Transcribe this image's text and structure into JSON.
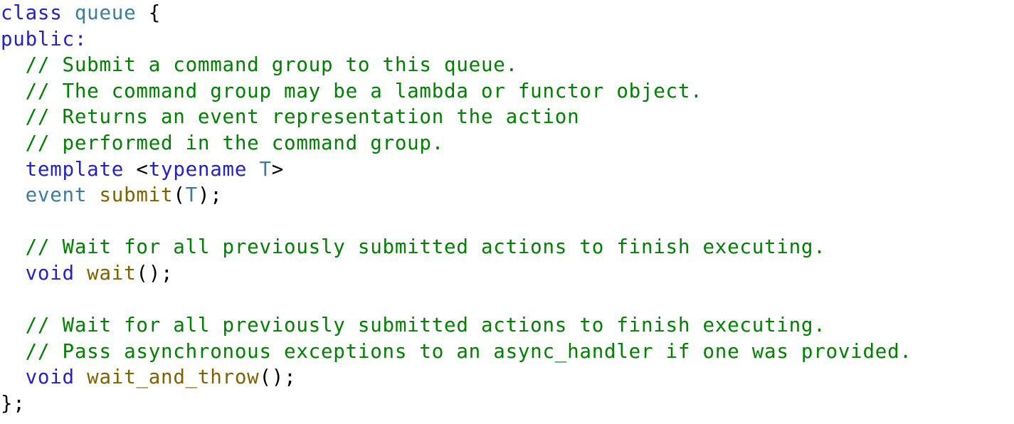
{
  "document": {
    "kind": "source-code-listing",
    "language": "C++",
    "background_color": "#ffffff"
  },
  "theme": {
    "keyword_color": "#2222cc",
    "type_color": "#3a7d9e",
    "function_color": "#806000",
    "comment_color": "#008000",
    "punctuation_color": "#000000"
  },
  "code": {
    "lines": [
      {
        "index": 1,
        "text": "class queue {",
        "tokens": [
          {
            "text": "class",
            "kind": "keyword"
          },
          {
            "text": " ",
            "kind": "plain"
          },
          {
            "text": "queue",
            "kind": "type"
          },
          {
            "text": " ",
            "kind": "plain"
          },
          {
            "text": "{",
            "kind": "punct"
          }
        ]
      },
      {
        "index": 2,
        "text": "public:",
        "tokens": [
          {
            "text": "public",
            "kind": "keyword"
          },
          {
            "text": ":",
            "kind": "keyword"
          }
        ]
      },
      {
        "index": 3,
        "text": "  // Submit a command group to this queue.",
        "tokens": [
          {
            "text": "  ",
            "kind": "plain"
          },
          {
            "text": "// Submit a command group to this queue.",
            "kind": "comment"
          }
        ]
      },
      {
        "index": 4,
        "text": "  // The command group may be a lambda or functor object.",
        "tokens": [
          {
            "text": "  ",
            "kind": "plain"
          },
          {
            "text": "// The command group may be a lambda or functor object.",
            "kind": "comment"
          }
        ]
      },
      {
        "index": 5,
        "text": "  // Returns an event representation the action",
        "tokens": [
          {
            "text": "  ",
            "kind": "plain"
          },
          {
            "text": "// Returns an event representation the action",
            "kind": "comment"
          }
        ]
      },
      {
        "index": 6,
        "text": "  // performed in the command group.",
        "tokens": [
          {
            "text": "  ",
            "kind": "plain"
          },
          {
            "text": "// performed in the command group.",
            "kind": "comment"
          }
        ]
      },
      {
        "index": 7,
        "text": "  template <typename T>",
        "tokens": [
          {
            "text": "  ",
            "kind": "plain"
          },
          {
            "text": "template",
            "kind": "keyword"
          },
          {
            "text": " ",
            "kind": "plain"
          },
          {
            "text": "<",
            "kind": "punct"
          },
          {
            "text": "typename",
            "kind": "keyword"
          },
          {
            "text": " ",
            "kind": "plain"
          },
          {
            "text": "T",
            "kind": "type"
          },
          {
            "text": ">",
            "kind": "punct"
          }
        ]
      },
      {
        "index": 8,
        "text": "  event submit(T);",
        "tokens": [
          {
            "text": "  ",
            "kind": "plain"
          },
          {
            "text": "event",
            "kind": "type"
          },
          {
            "text": " ",
            "kind": "plain"
          },
          {
            "text": "submit",
            "kind": "function"
          },
          {
            "text": "(",
            "kind": "punct"
          },
          {
            "text": "T",
            "kind": "type"
          },
          {
            "text": ");",
            "kind": "punct"
          }
        ]
      },
      {
        "index": 9,
        "text": "",
        "tokens": []
      },
      {
        "index": 10,
        "text": "  // Wait for all previously submitted actions to finish executing.",
        "tokens": [
          {
            "text": "  ",
            "kind": "plain"
          },
          {
            "text": "// Wait for all previously submitted actions to finish executing.",
            "kind": "comment"
          }
        ]
      },
      {
        "index": 11,
        "text": "  void wait();",
        "tokens": [
          {
            "text": "  ",
            "kind": "plain"
          },
          {
            "text": "void",
            "kind": "keyword"
          },
          {
            "text": " ",
            "kind": "plain"
          },
          {
            "text": "wait",
            "kind": "function"
          },
          {
            "text": "();",
            "kind": "punct"
          }
        ]
      },
      {
        "index": 12,
        "text": "",
        "tokens": []
      },
      {
        "index": 13,
        "text": "  // Wait for all previously submitted actions to finish executing.",
        "tokens": [
          {
            "text": "  ",
            "kind": "plain"
          },
          {
            "text": "// Wait for all previously submitted actions to finish executing.",
            "kind": "comment"
          }
        ]
      },
      {
        "index": 14,
        "text": "  // Pass asynchronous exceptions to an async_handler if one was provided.",
        "tokens": [
          {
            "text": "  ",
            "kind": "plain"
          },
          {
            "text": "// Pass asynchronous exceptions to an async_handler if one was provided.",
            "kind": "comment"
          }
        ]
      },
      {
        "index": 15,
        "text": "  void wait_and_throw();",
        "tokens": [
          {
            "text": "  ",
            "kind": "plain"
          },
          {
            "text": "void",
            "kind": "keyword"
          },
          {
            "text": " ",
            "kind": "plain"
          },
          {
            "text": "wait_and_throw",
            "kind": "function"
          },
          {
            "text": "();",
            "kind": "punct"
          }
        ]
      },
      {
        "index": 16,
        "text": "};",
        "tokens": [
          {
            "text": "};",
            "kind": "punct"
          }
        ]
      }
    ]
  }
}
